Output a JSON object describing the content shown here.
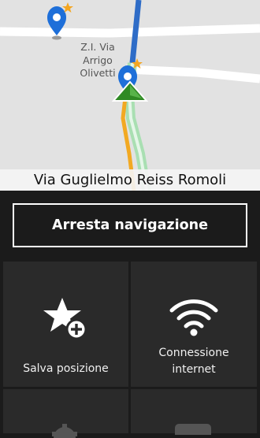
{
  "map": {
    "poi_label_lines": [
      "Z.I. Via",
      "Arrigo",
      "Olivetti"
    ],
    "icons": [
      "poi-pin-star-icon",
      "poi-pin-star-icon",
      "navigation-arrow-icon"
    ],
    "colors": {
      "map_bg": "#e2e2e2",
      "road": "#ffffff",
      "route_blue": "#2e6cc7",
      "route_green": "#8fd19a",
      "route_orange": "#f2a922",
      "pin": "#1e6fd9",
      "arrow": "#3b8f2a"
    }
  },
  "street_name": "Via Guglielmo Reiss Romoli",
  "panel": {
    "stop_button": "Arresta navigazione",
    "tiles": [
      {
        "label": "Salva posizione",
        "icon": "star-add-icon"
      },
      {
        "label": "Connessione internet",
        "icon": "wifi-icon"
      },
      {
        "label": "",
        "icon": "settings-gear-icon"
      },
      {
        "label": "",
        "icon": "tile-icon"
      }
    ]
  }
}
